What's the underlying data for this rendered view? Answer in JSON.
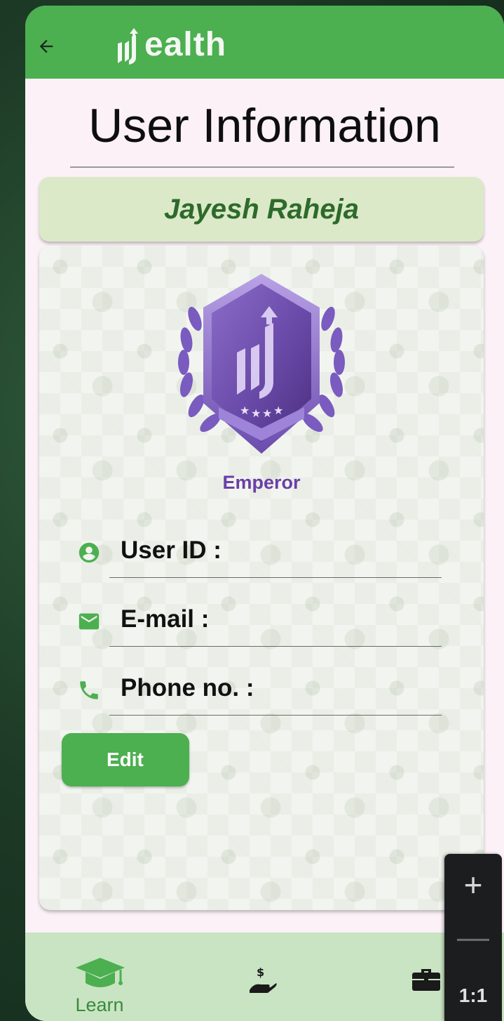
{
  "app": {
    "brand_text": "ealth",
    "brand_color": "#4caf50"
  },
  "header": {
    "back_icon": "arrow-left-icon"
  },
  "page": {
    "title": "User Information"
  },
  "profile": {
    "name": "Jayesh Raheja",
    "rank": "Emperor",
    "rank_color": "#6a3fa8"
  },
  "fields": [
    {
      "icon": "account-circle-icon",
      "label": "User ID :"
    },
    {
      "icon": "email-icon",
      "label": "E-mail :"
    },
    {
      "icon": "phone-icon",
      "label": "Phone no. :"
    }
  ],
  "actions": {
    "edit_label": "Edit"
  },
  "bottom_nav": {
    "items": [
      {
        "icon": "graduation-cap-icon",
        "label": "Learn",
        "active": true
      },
      {
        "icon": "hand-money-icon",
        "label": ""
      },
      {
        "icon": "briefcase-icon",
        "label": ""
      }
    ]
  },
  "zoom_controls": {
    "zoom_in": "+",
    "zoom_out": "—",
    "reset": "1:1"
  }
}
